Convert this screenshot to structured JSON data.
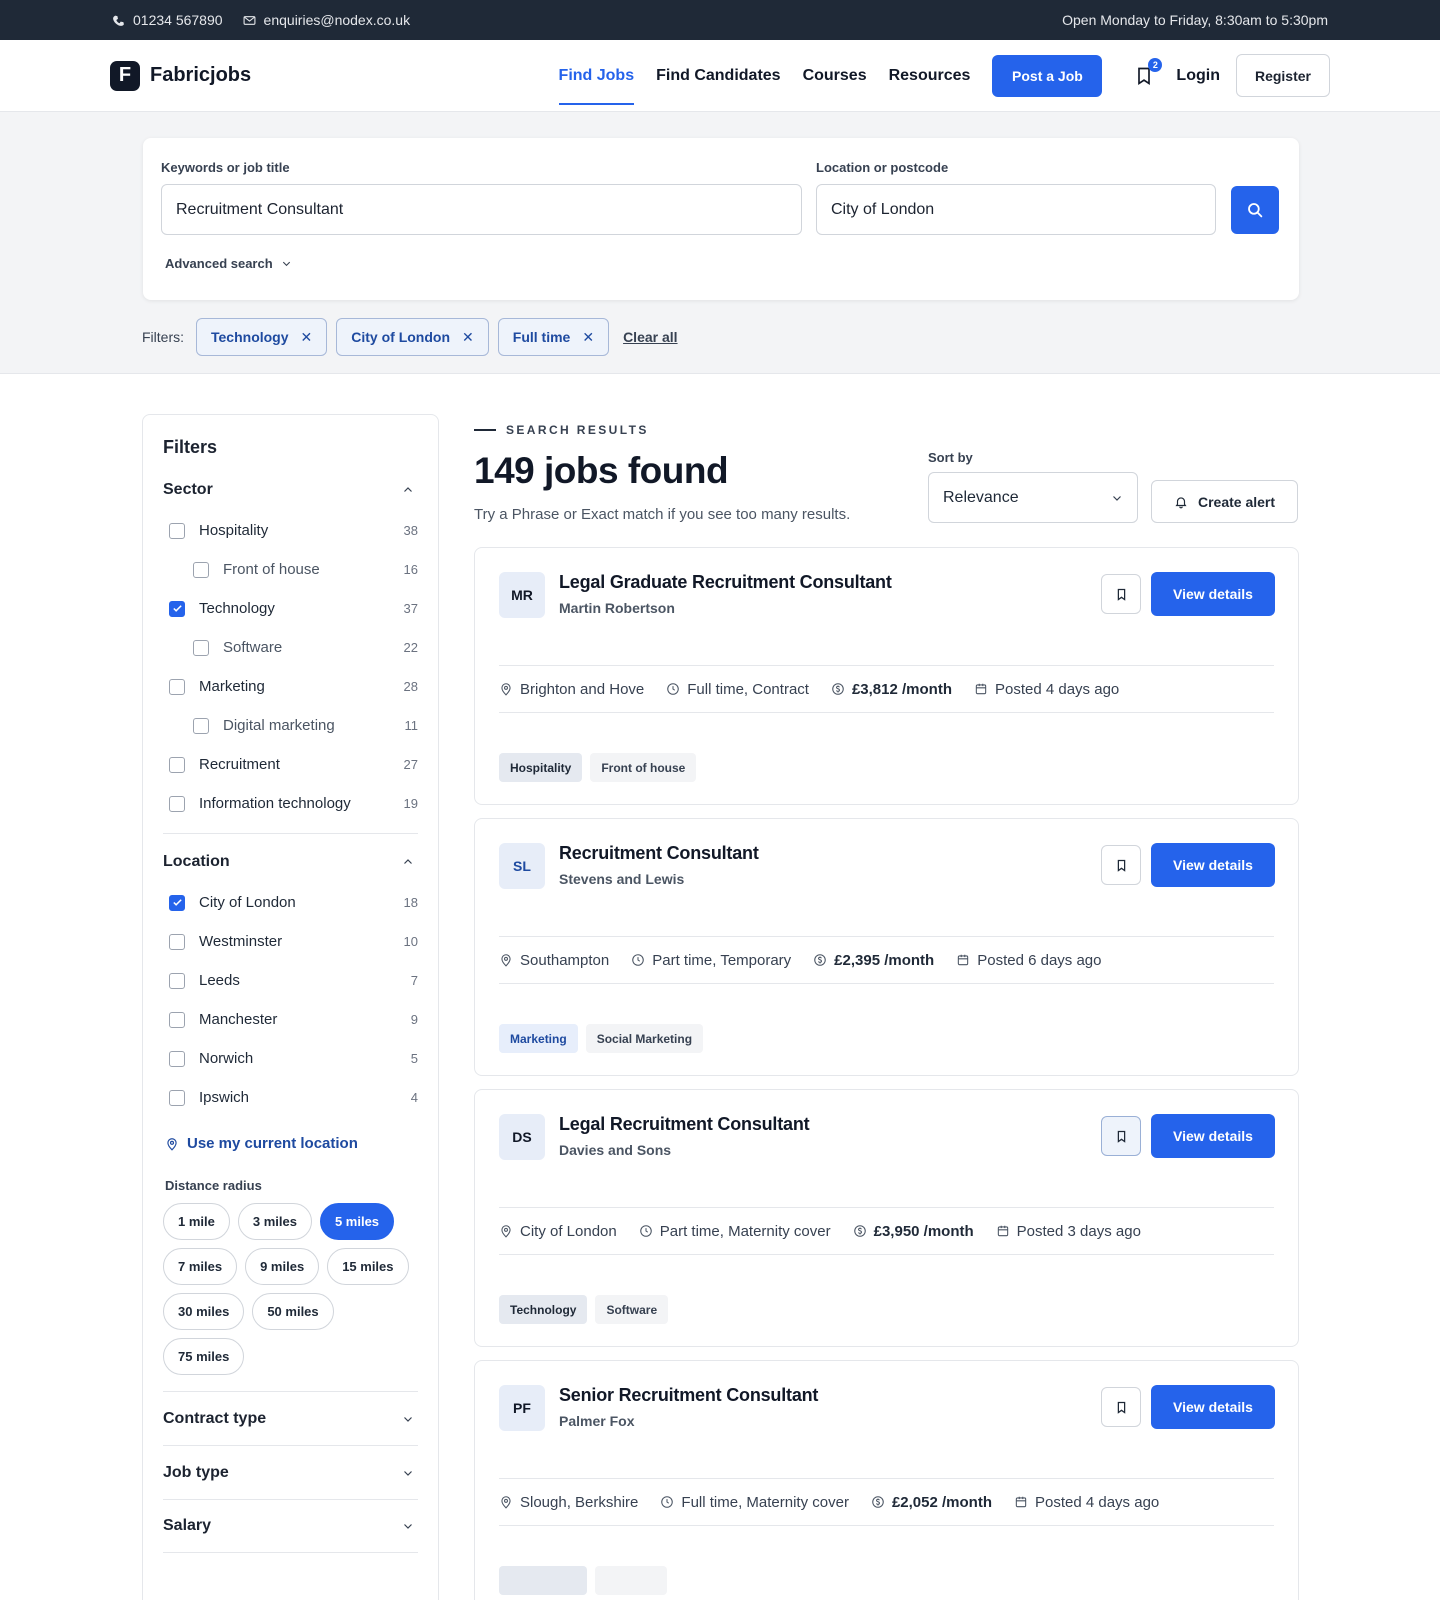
{
  "topbar": {
    "phone": "01234 567890",
    "email": "enquiries@nodex.co.uk",
    "hours": "Open Monday to Friday, 8:30am to 5:30pm"
  },
  "header": {
    "logo_letter": "F",
    "brand": "Fabricjobs",
    "nav": [
      "Find Jobs",
      "Find Candidates",
      "Courses",
      "Resources"
    ],
    "active_nav": "Find Jobs",
    "post_job": "Post a Job",
    "saved_count": "2",
    "login": "Login",
    "register": "Register"
  },
  "search": {
    "keywords_label": "Keywords or job title",
    "keywords_value": "Recruitment Consultant",
    "location_label": "Location or postcode",
    "location_value": "City of London",
    "advanced": "Advanced search"
  },
  "active_filters": {
    "label": "Filters:",
    "chips": [
      "Technology",
      "City of London",
      "Full time"
    ],
    "clear": "Clear all"
  },
  "sidebar": {
    "title": "Filters",
    "sector": {
      "title": "Sector",
      "items": [
        {
          "label": "Hospitality",
          "count": "38",
          "sub": false,
          "checked": false
        },
        {
          "label": "Front of house",
          "count": "16",
          "sub": true,
          "checked": false
        },
        {
          "label": "Technology",
          "count": "37",
          "sub": false,
          "checked": true
        },
        {
          "label": "Software",
          "count": "22",
          "sub": true,
          "checked": false
        },
        {
          "label": "Marketing",
          "count": "28",
          "sub": false,
          "checked": false
        },
        {
          "label": "Digital marketing",
          "count": "11",
          "sub": true,
          "checked": false
        },
        {
          "label": "Recruitment",
          "count": "27",
          "sub": false,
          "checked": false
        },
        {
          "label": "Information technology",
          "count": "19",
          "sub": false,
          "checked": false
        }
      ]
    },
    "location": {
      "title": "Location",
      "items": [
        {
          "label": "City of London",
          "count": "18",
          "checked": true
        },
        {
          "label": "Westminster",
          "count": "10",
          "checked": false
        },
        {
          "label": "Leeds",
          "count": "7",
          "checked": false
        },
        {
          "label": "Manchester",
          "count": "9",
          "checked": false
        },
        {
          "label": "Norwich",
          "count": "5",
          "checked": false
        },
        {
          "label": "Ipswich",
          "count": "4",
          "checked": false
        }
      ],
      "use_location": "Use my current location",
      "distance_label": "Distance radius",
      "distances": [
        "1 mile",
        "3 miles",
        "5 miles",
        "7 miles",
        "9 miles",
        "15 miles",
        "30 miles",
        "50 miles",
        "75 miles"
      ],
      "active_distance": "5 miles"
    },
    "collapsed": [
      "Contract type",
      "Job type",
      "Salary"
    ]
  },
  "results": {
    "eyebrow": "SEARCH RESULTS",
    "count_text": "149 jobs found",
    "hint": "Try a Phrase or Exact match if you see too many results.",
    "sort_label": "Sort by",
    "sort_value": "Relevance",
    "create_alert": "Create alert",
    "view_details": "View details",
    "jobs": [
      {
        "initials": "MR",
        "title": "Legal Graduate Recruitment Consultant",
        "company": "Martin Robertson",
        "location": "Brighton and Hove",
        "type": "Full time, Contract",
        "salary": "£3,812 /month",
        "posted": "Posted 4 days ago",
        "tags": [
          "Hospitality",
          "Front of house"
        ],
        "saved": false
      },
      {
        "initials": "SL",
        "title": "Recruitment Consultant",
        "company": "Stevens and Lewis",
        "location": "Southampton",
        "type": "Part time, Temporary",
        "salary": "£2,395 /month",
        "posted": "Posted 6 days ago",
        "tags": [
          "Marketing",
          "Social Marketing"
        ],
        "saved": false
      },
      {
        "initials": "DS",
        "title": "Legal Recruitment Consultant",
        "company": "Davies and Sons",
        "location": "City of London",
        "type": "Part time, Maternity cover",
        "salary": "£3,950 /month",
        "posted": "Posted 3 days ago",
        "tags": [
          "Technology",
          "Software"
        ],
        "saved": true
      },
      {
        "initials": "PF",
        "title": "Senior Recruitment Consultant",
        "company": "Palmer Fox",
        "location": "Slough, Berkshire",
        "type": "Full time, Maternity cover",
        "salary": "£2,052 /month",
        "posted": "Posted 4 days ago",
        "tags": [
          "",
          ""
        ],
        "saved": false
      }
    ]
  },
  "colors": {
    "accent": "#2563eb",
    "topbar": "#1f2937",
    "chip_bg": "#eef3fb"
  },
  "icons": [
    "phone-icon",
    "mail-icon",
    "bookmark-icon",
    "search-icon",
    "chevron-down-icon",
    "chevron-up-icon",
    "close-icon",
    "location-pin-icon",
    "clock-icon",
    "currency-icon",
    "calendar-icon",
    "bell-icon",
    "check-icon"
  ]
}
